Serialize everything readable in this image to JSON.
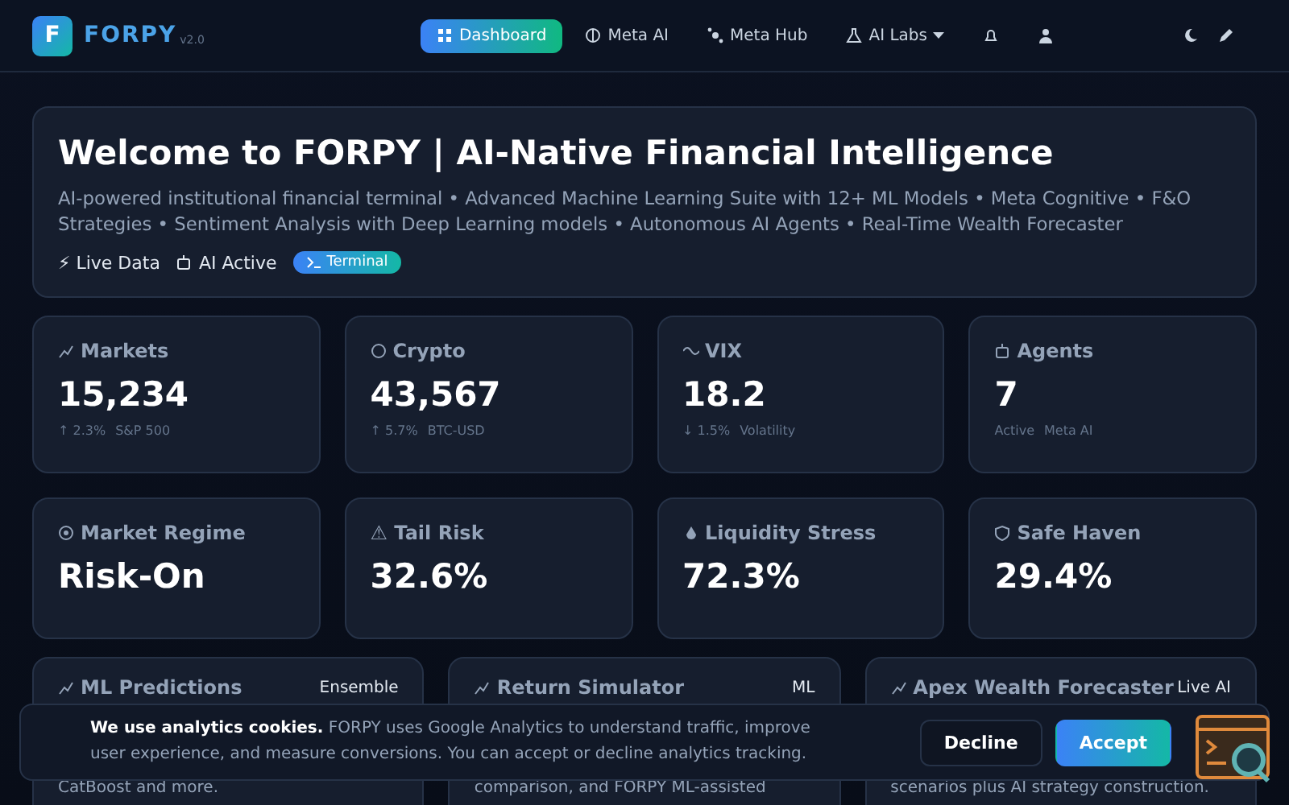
{
  "brand": {
    "logo_letter": "F",
    "name": "FORPY",
    "version": "v2.0"
  },
  "nav": [
    {
      "kind": "tab",
      "label": "Dashboard",
      "selected": true
    },
    {
      "kind": "tab",
      "label": "Meta AI",
      "selected": false
    },
    {
      "kind": "tab",
      "label": "Meta Hub",
      "selected": false
    },
    {
      "kind": "tab",
      "label": "AI Labs",
      "selected": false,
      "dropdown": true
    },
    {
      "kind": "icon",
      "selected": false
    },
    {
      "kind": "icon",
      "selected": false
    }
  ],
  "hero": {
    "title": "Welcome to FORPY | AI-Native Financial Intelligence",
    "subtitle": "AI-powered institutional financial terminal • Advanced Machine Learning Suite with 12+ ML Models • Meta Cognitive • F&O Strategies • Sentiment Analysis with Deep Learning models • Autonomous AI Agents • Real-Time Wealth Forecaster",
    "tags": [
      {
        "kind": "text",
        "label": "⚡ Live Data"
      },
      {
        "kind": "text",
        "label": "AI Active"
      },
      {
        "kind": "pill",
        "label": "Terminal"
      }
    ]
  },
  "stats": [
    {
      "label": "Markets",
      "value": "15,234",
      "change": "↑ 2.3%",
      "note": "S&P 500"
    },
    {
      "label": "Crypto",
      "value": "43,567",
      "change": "↑ 5.7%",
      "note": "BTC-USD"
    },
    {
      "label": "VIX",
      "value": "18.2",
      "change": "↓ 1.5%",
      "note": "Volatility"
    },
    {
      "label": "Agents",
      "value": "7",
      "change": "Active",
      "note": "Meta AI"
    },
    {
      "label": "Market Regime",
      "value": "Risk-On"
    },
    {
      "label": "⚠ Tail Risk",
      "value": "32.6%"
    },
    {
      "label": "Liquidity Stress",
      "value": "72.3%"
    },
    {
      "label": "Safe Haven",
      "value": "29.4%"
    }
  ],
  "features": [
    {
      "title": "ML Predictions",
      "badge": "Ensemble",
      "text": "CatBoost and more."
    },
    {
      "title": "Return Simulator",
      "badge": "ML",
      "text": "comparison, and FORPY ML-assisted"
    },
    {
      "title": "Apex Wealth Forecaster",
      "badge": "Live AI",
      "text": "scenarios plus AI strategy construction."
    }
  ],
  "cookie": {
    "text": "**We use analytics cookies.** FORPY uses Google Analytics to understand traffic, improve user experience, and measure conversions. You can accept or decline analytics tracking.",
    "buttons": [
      {
        "label": "Decline",
        "kind": "secondary"
      },
      {
        "label": "Accept",
        "kind": "primary"
      }
    ]
  }
}
